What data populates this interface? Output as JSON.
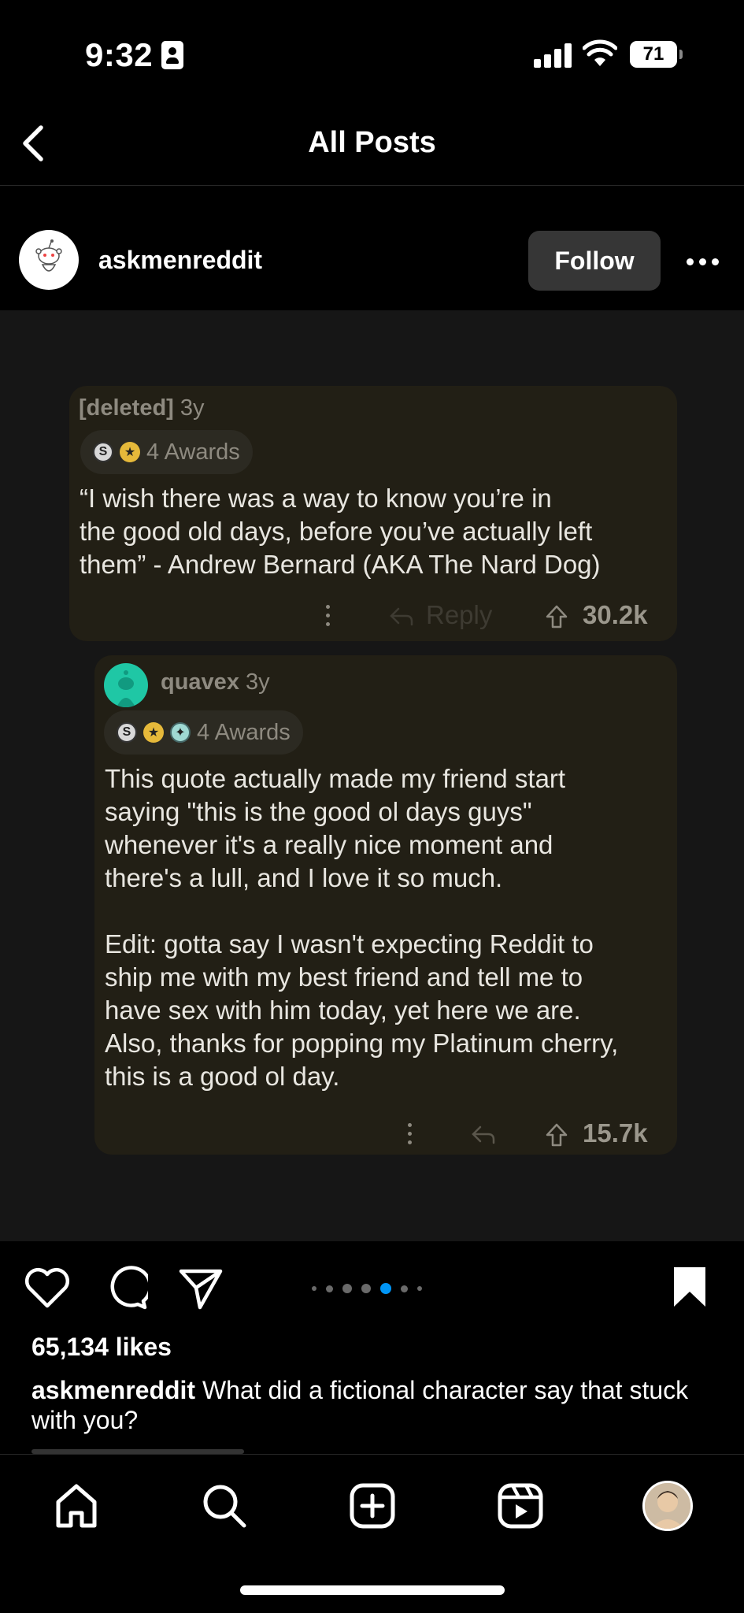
{
  "status_bar": {
    "time": "9:32",
    "battery": "71"
  },
  "header": {
    "title": "All Posts"
  },
  "post": {
    "author": "askmenreddit",
    "follow_label": "Follow",
    "comments": [
      {
        "user": "[deleted]",
        "age": "3y",
        "awards": "4 Awards",
        "body": "“I wish there was a way to know you’re in\nthe good old days, before you’ve actually left\nthem” - Andrew Bernard (AKA The Nard Dog)",
        "reply_label": "Reply",
        "votes": "30.2k"
      },
      {
        "user": "quavex",
        "age": "3y",
        "awards": "4 Awards",
        "body": "This quote actually made my friend start\nsaying \"this is the good ol days guys\"\nwhenever it's a really nice moment and\nthere's a lull, and I love it so much.\n\nEdit: gotta say I wasn't expecting Reddit to\nship me with my best friend and tell me to\nhave sex with him today, yet here we are.\nAlso, thanks for popping my Platinum cherry,\nthis is a good ol day.",
        "votes": "15.7k"
      }
    ],
    "carousel": {
      "active_index": 4,
      "count": 7
    },
    "likes": "65,134 likes",
    "caption_author": "askmenreddit",
    "caption_text": "What did a fictional character say that stuck with you?"
  },
  "colors": {
    "accent": "#0095f6",
    "comment_bg": "#221f15",
    "follow_bg": "#363636"
  }
}
